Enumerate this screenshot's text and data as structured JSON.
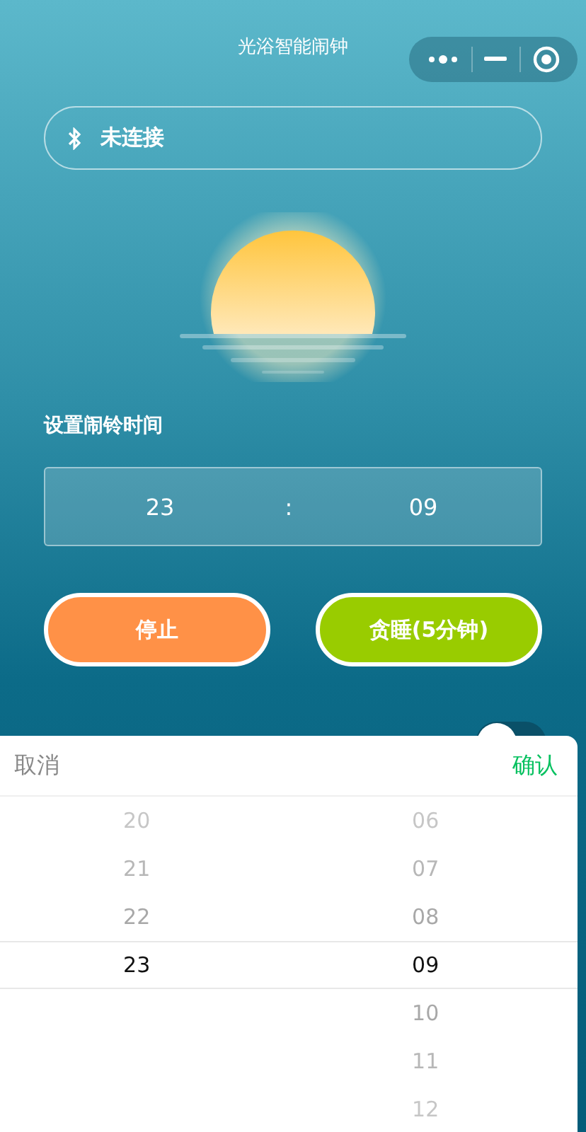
{
  "nav_bar": {
    "title": "光浴智能闹钟"
  },
  "connection": {
    "status": "未连接"
  },
  "alarm": {
    "label": "设置闹铃时间",
    "hour": "23",
    "separator": ":",
    "minute": "09"
  },
  "buttons": [
    {
      "label": "停止",
      "kind": "stop"
    },
    {
      "label": "贪睡(5分钟)",
      "kind": "snooze"
    }
  ],
  "toggle": {
    "on": false
  },
  "picker": {
    "cancel": "取消",
    "confirm": "确认",
    "columns": [
      {
        "items": [
          {
            "text": "20",
            "selected": false
          },
          {
            "text": "21",
            "selected": false
          },
          {
            "text": "22",
            "selected": false
          },
          {
            "text": "23",
            "selected": true
          }
        ]
      },
      {
        "items": [
          {
            "text": "06",
            "selected": false
          },
          {
            "text": "07",
            "selected": false
          },
          {
            "text": "08",
            "selected": false
          },
          {
            "text": "09",
            "selected": true
          },
          {
            "text": "10",
            "selected": false
          },
          {
            "text": "11",
            "selected": false
          },
          {
            "text": "12",
            "selected": false
          }
        ]
      }
    ]
  }
}
